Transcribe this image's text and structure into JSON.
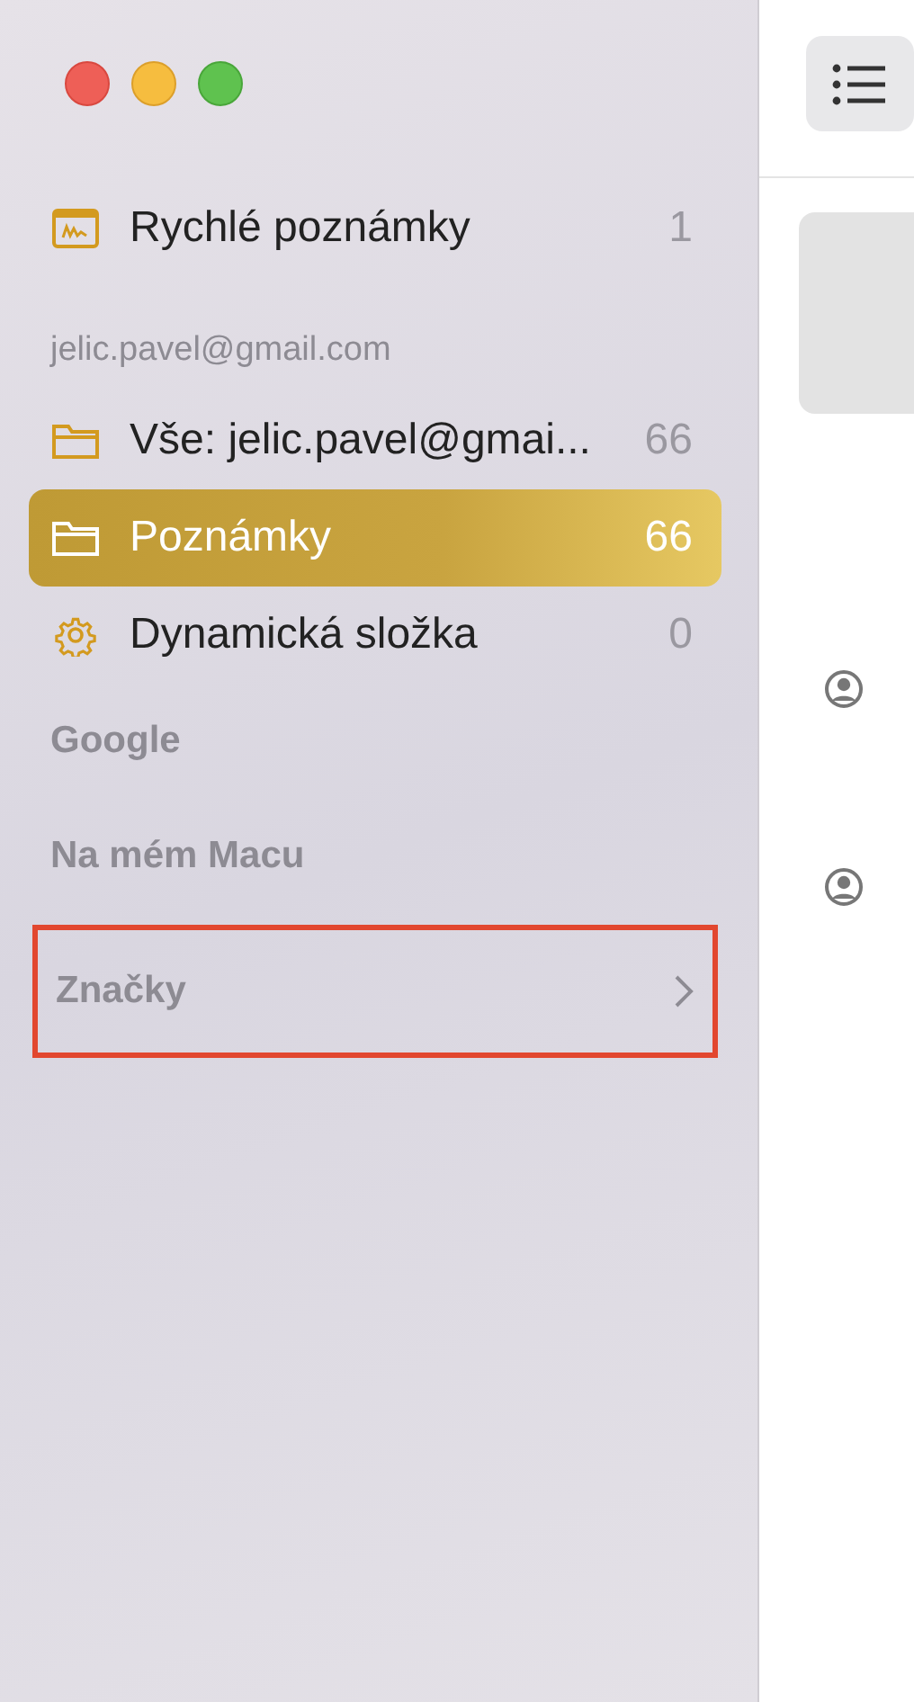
{
  "window": {
    "controls": [
      {
        "kind": "close"
      },
      {
        "kind": "minimize"
      },
      {
        "kind": "zoom"
      }
    ]
  },
  "sidebar": {
    "items": [
      {
        "kind": "quick-note",
        "label": "Rychlé poznámky",
        "count": "1",
        "selected": false
      }
    ],
    "sections": [
      {
        "header": "jelic.pavel@gmail.com",
        "items": [
          {
            "kind": "folder",
            "label": "Vše: jelic.pavel@gmai...",
            "count": "66",
            "selected": false
          },
          {
            "kind": "folder",
            "label": "Poznámky",
            "count": "66",
            "selected": true
          },
          {
            "kind": "smart-folder",
            "label": "Dynamická složka",
            "count": "0",
            "selected": false
          }
        ]
      },
      {
        "header": "Google"
      },
      {
        "header": "Na mém Macu"
      }
    ],
    "tags": {
      "label": "Značky",
      "highlighted": true
    }
  }
}
